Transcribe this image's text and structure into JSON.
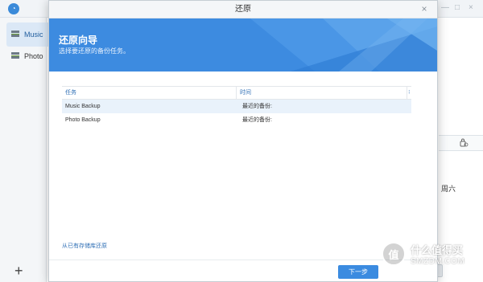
{
  "background": {
    "sidebar": {
      "items": [
        {
          "label": "Music"
        },
        {
          "label": "Photo"
        }
      ],
      "add_label": "+"
    },
    "edge_text": "周六"
  },
  "dialog": {
    "title": "还原",
    "close_label": "×",
    "banner": {
      "title": "还原向导",
      "subtitle": "选择要还原的备份任务。"
    },
    "table": {
      "headers": [
        "任务",
        "时间"
      ],
      "extra_header": "⁝",
      "rows": [
        {
          "task": "Music Backup",
          "time": "最近的备份:"
        },
        {
          "task": "Photo Backup",
          "time": "最近的备份:"
        }
      ]
    },
    "restore_link": "从已有存储库还原",
    "next_label": "下一步"
  },
  "watermark": {
    "badge": "值",
    "text": "什么值得买",
    "sub": "SMZDM.COM"
  },
  "colors": {
    "accent": "#3b8be0",
    "banner": "#3d8be0",
    "link": "#2f6fb5",
    "selected_row": "#e9f2fb"
  }
}
